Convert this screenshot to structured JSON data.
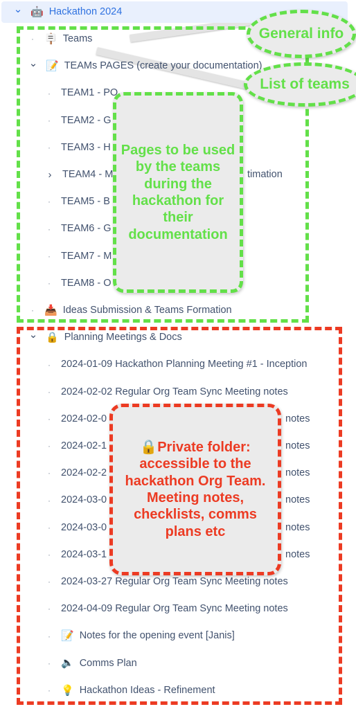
{
  "tree": {
    "root": {
      "label": "Hackathon 2024",
      "icon": "robot-emoji",
      "icon_glyph": "🤖",
      "chevron": "⌄"
    },
    "items": [
      {
        "label": "Teams",
        "icon_glyph": "🪧",
        "indent": 1,
        "marker": "bullet"
      },
      {
        "label": "TEAMs PAGES (create your documentation)",
        "icon_glyph": "📝",
        "indent": 1,
        "marker": "chevron-down"
      },
      {
        "label": "TEAM1 - PO",
        "indent": 2,
        "marker": "bullet"
      },
      {
        "label": "TEAM2 - G",
        "indent": 2,
        "marker": "bullet"
      },
      {
        "label": "TEAM3 - H",
        "indent": 2,
        "marker": "bullet"
      },
      {
        "label": "TEAM4 - M",
        "label_tail": "timation",
        "indent": 2,
        "marker": "chevron-right"
      },
      {
        "label": "TEAM5 - B",
        "indent": 2,
        "marker": "bullet"
      },
      {
        "label": "TEAM6 - G",
        "indent": 2,
        "marker": "bullet"
      },
      {
        "label": "TEAM7 - M",
        "indent": 2,
        "marker": "bullet"
      },
      {
        "label": "TEAM8 - O",
        "indent": 2,
        "marker": "bullet"
      },
      {
        "label": "Ideas Submission & Teams Formation",
        "icon_glyph": "📥",
        "indent": 1,
        "marker": "bullet"
      },
      {
        "label": "Planning Meetings & Docs",
        "icon_glyph": "🔒",
        "indent": 1,
        "marker": "chevron-down"
      },
      {
        "label": "2024-01-09 Hackathon Planning Meeting #1 - Inception",
        "indent": 2,
        "marker": "bullet"
      },
      {
        "label": "2024-02-02 Regular Org Team Sync Meeting notes",
        "indent": 2,
        "marker": "bullet"
      },
      {
        "label": "2024-02-0",
        "label_tail": "notes",
        "indent": 2,
        "marker": "bullet"
      },
      {
        "label": "2024-02-1",
        "label_tail": "notes",
        "indent": 2,
        "marker": "bullet"
      },
      {
        "label": "2024-02-2",
        "label_tail": "notes",
        "indent": 2,
        "marker": "bullet"
      },
      {
        "label": "2024-03-0",
        "label_tail": "notes",
        "indent": 2,
        "marker": "bullet"
      },
      {
        "label": "2024-03-0",
        "label_tail": "notes",
        "indent": 2,
        "marker": "bullet"
      },
      {
        "label": "2024-03-1",
        "label_tail": "notes",
        "indent": 2,
        "marker": "bullet"
      },
      {
        "label": "2024-03-27 Regular Org Team Sync Meeting notes",
        "indent": 2,
        "marker": "bullet"
      },
      {
        "label": "2024-04-09 Regular Org Team Sync Meeting notes",
        "indent": 2,
        "marker": "bullet"
      },
      {
        "label": "Notes for the opening event [Janis]",
        "icon_glyph": "📝",
        "indent": 2,
        "marker": "bullet"
      },
      {
        "label": "Comms Plan",
        "icon_glyph": "🔈",
        "indent": 2,
        "marker": "bullet"
      },
      {
        "label": "Hackathon Ideas - Refinement",
        "icon_glyph": "💡",
        "indent": 2,
        "marker": "bullet"
      }
    ]
  },
  "annotations": {
    "general_info": "General info",
    "list_of_teams": "List of teams",
    "pages_note": "Pages to be used by the teams during the hackathon for their documentation",
    "private_note": "🔒Private folder: accessible to the hackathon Org Team.\nMeeting notes, checklists, comms plans etc"
  },
  "colors": {
    "green": "#63e049",
    "red": "#ec3b23",
    "link_blue": "#2f72e0",
    "text": "#42526e",
    "row_highlight": "#e9f0fd",
    "callout_bg": "#ebebeb"
  }
}
